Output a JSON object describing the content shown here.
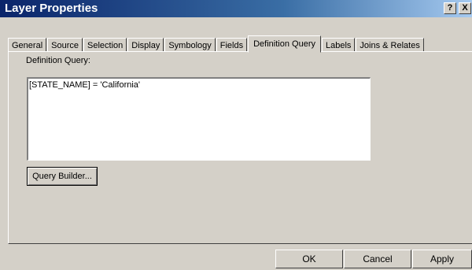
{
  "window": {
    "title": "Layer Properties",
    "help_label": "?",
    "close_label": "X"
  },
  "tabs": [
    {
      "label": "General"
    },
    {
      "label": "Source"
    },
    {
      "label": "Selection"
    },
    {
      "label": "Display"
    },
    {
      "label": "Symbology"
    },
    {
      "label": "Fields"
    },
    {
      "label": "Definition Query",
      "active": true
    },
    {
      "label": "Labels"
    },
    {
      "label": "Joins & Relates"
    }
  ],
  "definition_query": {
    "label": "Definition Query:",
    "value": "[STATE_NAME] = 'California'",
    "builder_button": "Query Builder..."
  },
  "footer": {
    "ok": "OK",
    "cancel": "Cancel",
    "apply": "Apply"
  }
}
